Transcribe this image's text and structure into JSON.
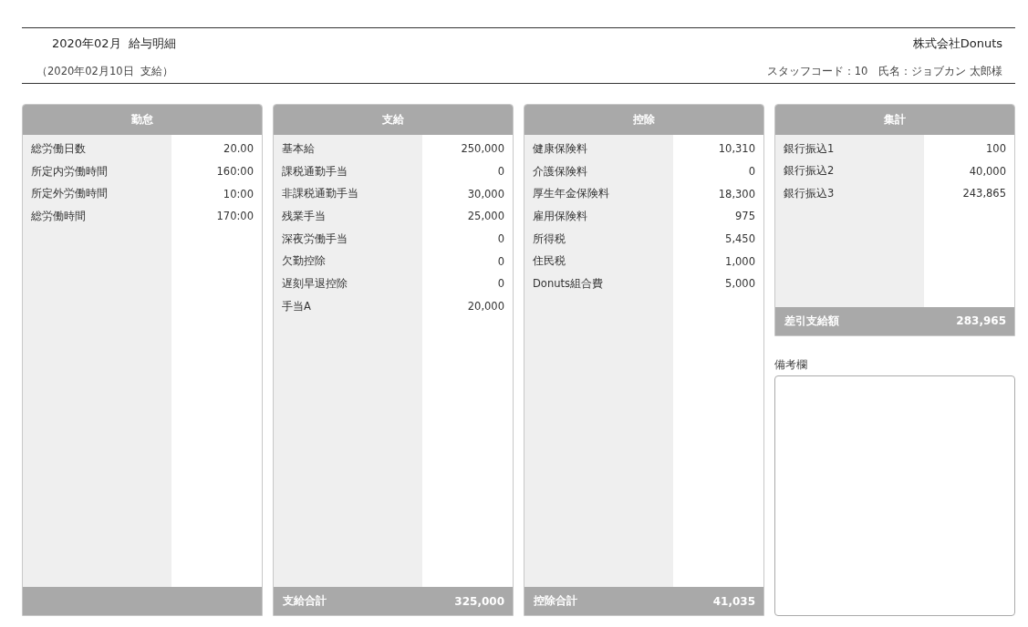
{
  "header": {
    "title": "2020年02月  給与明細",
    "payday": "（2020年02月10日  支給）",
    "company": "株式会社Donuts",
    "staff": "スタッフコード：10　氏名：ジョブカン 太郎様"
  },
  "panels": [
    {
      "kind": "column",
      "title": "勤怠",
      "rows": [
        {
          "label": "総労働日数",
          "value": "20.00"
        },
        {
          "label": "所定内労働時間",
          "value": "160:00"
        },
        {
          "label": "所定外労働時間",
          "value": "10:00"
        },
        {
          "label": "総労働時間",
          "value": "170:00"
        }
      ]
    },
    {
      "kind": "column",
      "title": "支給",
      "rows": [
        {
          "label": "基本給",
          "value": "250,000"
        },
        {
          "label": "課税通勤手当",
          "value": "0"
        },
        {
          "label": "非課税通勤手当",
          "value": "30,000"
        },
        {
          "label": "残業手当",
          "value": "25,000"
        },
        {
          "label": "深夜労働手当",
          "value": "0"
        },
        {
          "label": "欠勤控除",
          "value": "0"
        },
        {
          "label": "遅刻早退控除",
          "value": "0"
        },
        {
          "label": "手当A",
          "value": "20,000"
        }
      ],
      "total": {
        "label": "支給合計",
        "value": "325,000"
      }
    },
    {
      "kind": "column",
      "title": "控除",
      "rows": [
        {
          "label": "健康保険料",
          "value": "10,310"
        },
        {
          "label": "介護保険料",
          "value": "0"
        },
        {
          "label": "厚生年金保険料",
          "value": "18,300"
        },
        {
          "label": "雇用保険料",
          "value": "975"
        },
        {
          "label": "所得税",
          "value": "5,450"
        },
        {
          "label": "住民税",
          "value": "1,000"
        },
        {
          "label": "Donuts組合費",
          "value": "5,000"
        }
      ],
      "total": {
        "label": "控除合計",
        "value": "41,035"
      }
    },
    {
      "kind": "summary",
      "title": "集計",
      "rows": [
        {
          "label": "銀行振込1",
          "value": "100"
        },
        {
          "label": "銀行振込2",
          "value": "40,000"
        },
        {
          "label": "銀行振込3",
          "value": "243,865"
        }
      ],
      "total": {
        "label": "差引支給額",
        "value": "283,965"
      }
    }
  ],
  "remarks": {
    "label": "備考欄"
  }
}
